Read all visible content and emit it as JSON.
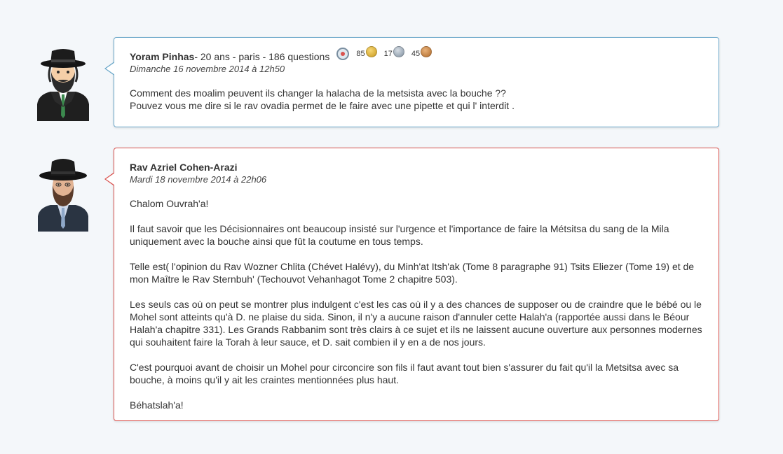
{
  "question": {
    "author": "Yoram Pinhas",
    "meta": " - 20 ans - paris - 186 questions",
    "badges": {
      "gold_count": "85",
      "silver_count": "17",
      "bronze_count": "45"
    },
    "date": "Dimanche 16 novembre 2014 à 12h50",
    "body": [
      "Comment des moalim peuvent ils changer la halacha de la metsista avec la bouche ??",
      "Pouvez vous me dire si le rav ovadia permet de le faire avec une pipette et qui l' interdit ."
    ]
  },
  "answer": {
    "author": "Rav Azriel Cohen-Arazi",
    "date": "Mardi 18 novembre 2014 à 22h06",
    "paragraphs": [
      "Chalom Ouvrah'a!",
      "Il faut savoir que les Décisionnaires ont beaucoup insisté sur l'urgence et l'importance de faire la Métsitsa du sang de la Mila uniquement avec la bouche ainsi que fût la coutume en tous temps.",
      "Telle est( l'opinion du Rav Wozner Chlita (Chévet Halévy), du Minh'at Itsh'ak (Tome 8 paragraphe 91) Tsits Eliezer (Tome 19) et de mon Maître le Rav Sternbuh' (Techouvot Vehanhagot Tome 2 chapitre 503).",
      "Les seuls cas où on peut se montrer plus indulgent c'est les cas où il y a des chances de supposer ou de craindre que le bébé ou le Mohel sont atteints qu'à D. ne plaise du sida. Sinon,  il n'y a aucune raison d'annuler cette Halah'a (rapportée aussi dans le Béour Halah'a chapitre 331). Les Grands Rabbanim sont très clairs à ce sujet et ils ne laissent aucune ouverture aux personnes modernes qui souhaitent faire la Torah à leur sauce, et D. sait combien il y en a de nos jours.",
      "C'est pourquoi avant de choisir un Mohel pour circoncire son fils il faut avant tout bien s'assurer du fait qu'il la Metsitsa avec sa bouche, à moins qu'il y ait les craintes mentionnées plus haut.",
      "Béhatslah'a!"
    ]
  },
  "colors": {
    "question_border": "#6aa7c9",
    "answer_border": "#d9534f",
    "background": "#f4f7fa"
  },
  "icons": {
    "question_avatar": "user-avatar-icon",
    "answer_avatar": "rabbi-avatar-icon",
    "rank": "rank-icon",
    "gold_medal": "gold-medal-icon",
    "silver_medal": "silver-medal-icon",
    "bronze_medal": "bronze-medal-icon"
  }
}
